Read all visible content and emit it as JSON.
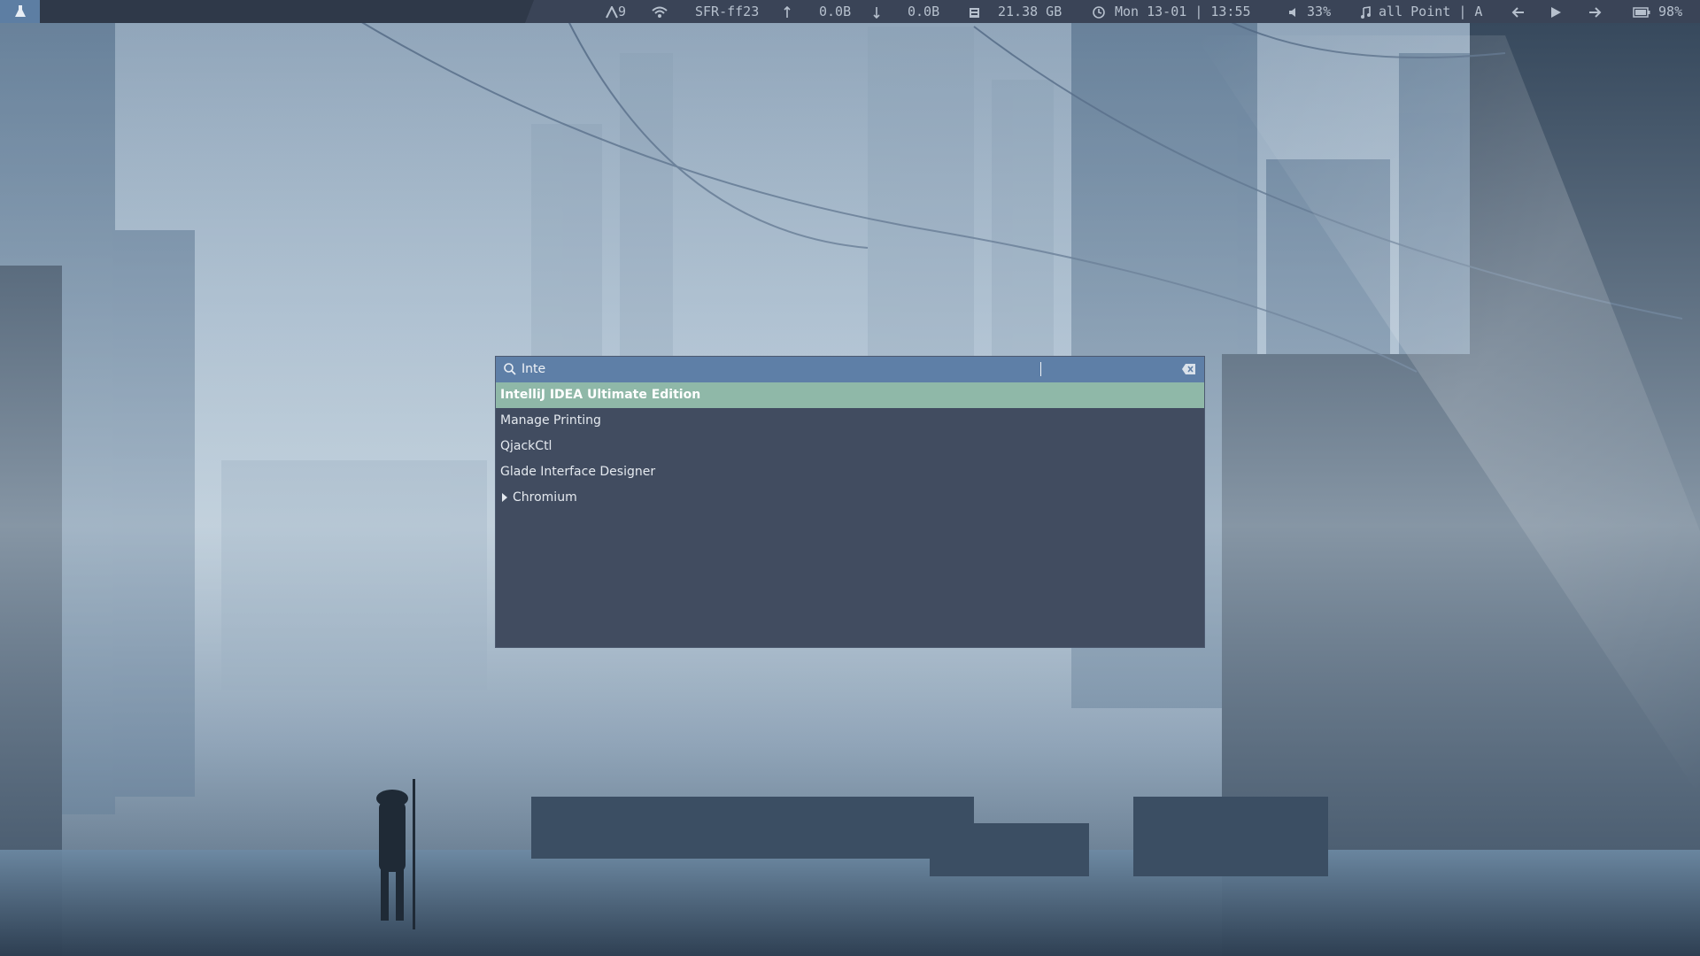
{
  "top_bar": {
    "launcher_icon": "flask-icon",
    "workspace": {
      "icon": "layout-icon",
      "label": "9"
    },
    "wifi": {
      "icon": "wifi-icon",
      "ssid": "SFR-ff23"
    },
    "upload": {
      "icon": "upload-arrow-icon",
      "value": "0.0B"
    },
    "download": {
      "icon": "download-arrow-icon",
      "value": "0.0B"
    },
    "disk": {
      "icon": "disk-icon",
      "free": "21.38 GB"
    },
    "clock": {
      "icon": "clock-icon",
      "date": "Mon 13-01",
      "separator": "|",
      "time": "13:55"
    },
    "volume": {
      "icon": "speaker-icon",
      "level": "33%"
    },
    "music": {
      "icon": "music-note-icon",
      "track": "all Point",
      "separator": "|",
      "extra": "A"
    },
    "media_controls": [
      "previous-icon",
      "play-icon",
      "next-icon"
    ],
    "battery": {
      "icon": "battery-icon",
      "level": "98%"
    }
  },
  "launcher": {
    "search": {
      "value": "Inte",
      "icon": "search-icon",
      "clear_icon": "clear-text-icon"
    },
    "results": [
      {
        "label": "IntelliJ IDEA Ultimate Edition",
        "selected": true
      },
      {
        "label": "Manage Printing",
        "selected": false
      },
      {
        "label": "QjackCtl",
        "selected": false
      },
      {
        "label": "Glade Interface Designer",
        "selected": false
      },
      {
        "label": "Chromium",
        "selected": false,
        "expandable": true
      }
    ]
  },
  "colors": {
    "bar_bg": "#2f3949",
    "bar_segment": "#3a4457",
    "accent_blue": "#5e7fa7",
    "selection_green": "#8fb8a8",
    "dialog_bg": "#414c60"
  }
}
